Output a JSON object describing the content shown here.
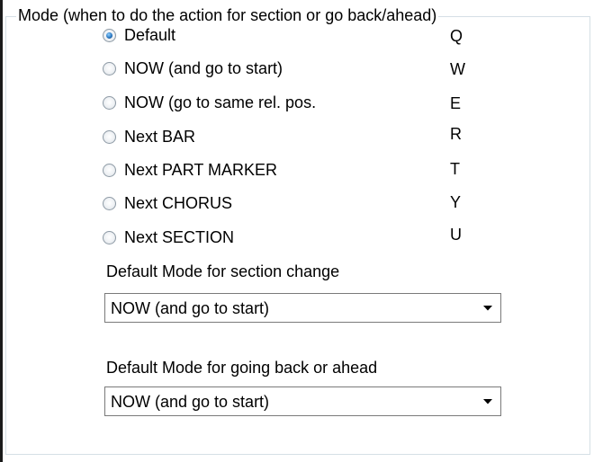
{
  "group": {
    "title": "Mode (when to do the action for section or go back/ahead)"
  },
  "modes": [
    {
      "label": "Default",
      "hotkey": "Q",
      "selected": true
    },
    {
      "label": "NOW (and go to start)",
      "hotkey": "W",
      "selected": false
    },
    {
      "label": "NOW (go to same rel. pos.",
      "hotkey": "E",
      "selected": false
    },
    {
      "label": "Next BAR",
      "hotkey": "R",
      "selected": false
    },
    {
      "label": "Next PART MARKER",
      "hotkey": "T",
      "selected": false
    },
    {
      "label": "Next CHORUS",
      "hotkey": "Y",
      "selected": false
    },
    {
      "label": "Next SECTION",
      "hotkey": "U",
      "selected": false
    }
  ],
  "section_change": {
    "label": "Default Mode for section change",
    "value": "NOW (and go to start)"
  },
  "back_ahead": {
    "label": "Default Mode for going back or ahead",
    "value": "NOW (and go to start)"
  },
  "icons": {
    "radio": "radio-button-icon",
    "dropdown": "chevron-down-icon"
  }
}
